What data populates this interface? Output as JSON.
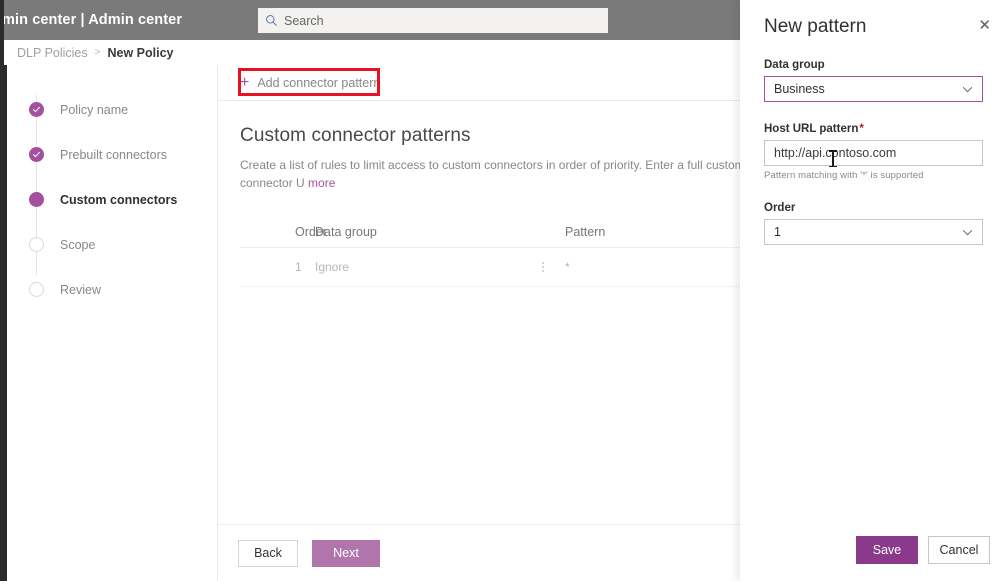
{
  "suite": {
    "title": "min center  |  Admin center",
    "search": {
      "placeholder": "Search",
      "icon": "search-icon"
    }
  },
  "breadcrumb": {
    "root": "DLP Policies",
    "separator": ">",
    "current": "New Policy"
  },
  "wizard": {
    "steps": [
      {
        "label": "Policy name",
        "state": "done"
      },
      {
        "label": "Prebuilt connectors",
        "state": "done"
      },
      {
        "label": "Custom connectors",
        "state": "active"
      },
      {
        "label": "Scope",
        "state": "todo"
      },
      {
        "label": "Review",
        "state": "todo"
      }
    ]
  },
  "main": {
    "command_bar": {
      "add_pattern_label": "Add connector pattern",
      "add_pattern_icon": "plus-icon"
    },
    "section": {
      "title": "Custom connector patterns",
      "description": "Create a list of rules to limit access to custom connectors in order of priority. Enter a full custom connector U",
      "link_label": "more"
    },
    "table": {
      "columns": [
        "Order",
        "Data group",
        "Pattern"
      ],
      "rows": [
        {
          "order": "1",
          "data_group": "Ignore",
          "pattern": "*",
          "menu_icon": "more-vertical-icon"
        }
      ]
    },
    "footer": {
      "back_label": "Back",
      "next_label": "Next"
    }
  },
  "panel": {
    "title": "New pattern",
    "close_icon": "close-icon",
    "data_group": {
      "label": "Data group",
      "value": "Business",
      "chevron_icon": "chevron-down-icon"
    },
    "host_url": {
      "label": "Host URL pattern",
      "required_marker": "*",
      "value": "http://api.contoso.com",
      "hint": "Pattern matching with '*' is supported"
    },
    "order": {
      "label": "Order",
      "value": "1",
      "chevron_icon": "chevron-down-icon"
    },
    "footer": {
      "save_label": "Save",
      "cancel_label": "Cancel"
    }
  },
  "colors": {
    "accent_purple": "#a4509f",
    "save_purple": "#8b3a8b",
    "next_purple": "#b076ab",
    "annotation_red": "#e81123",
    "suite_bar_gray": "#7a7a7a"
  }
}
